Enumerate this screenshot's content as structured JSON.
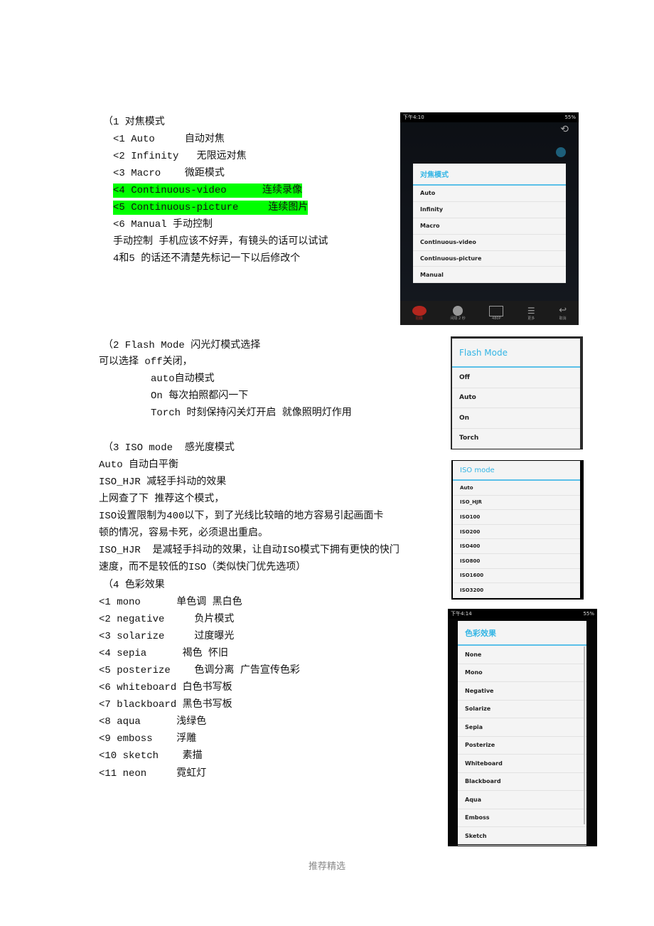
{
  "section1": {
    "lines": [
      "（1 对焦模式",
      "<1 Auto     自动对焦",
      "<2 Infinity   无限远对焦",
      "<3 Macro    微距模式",
      "<4 Continuous-video      连续录像",
      "<5 Continuous-picture     连续图片",
      "<6 Manual 手动控制",
      "手动控制 手机应该不好弄，有镜头的话可以试试",
      "4和5 的话还不清楚先标记一下以后修改个"
    ],
    "highlight_color": "#00ff00"
  },
  "section2": {
    "lines": [
      "（2 Flash Mode 闪光灯模式选择",
      "可以选择 off关闭，",
      "auto自动模式",
      "On 每次拍照都闪一下",
      "Torch 时刻保持闪关灯开启 就像照明灯作用"
    ]
  },
  "section3": {
    "lines": [
      "（3 ISO mode  感光度模式",
      "Auto 自动白平衡",
      "ISO_HJR 减轻手抖动的效果",
      "上网查了下 推荐这个模式，",
      "ISO设置限制为400以下，到了光线比较暗的地方容易引起画面卡",
      "顿的情况，容易卡死，必须退出重启。",
      "ISO_HJR  是减轻手抖动的效果，让自动ISO模式下拥有更快的快门",
      "速度，而不是较低的ISO（类似快门优先选项）"
    ]
  },
  "section4": {
    "lines": [
      "（4 色彩效果",
      "<1 mono      单色调 黑白色",
      "<2 negative     负片模式",
      "<3 solarize     过度曝光",
      "<4 sepia      褐色 怀旧",
      "<5 posterize    色调分离 广告宣传色彩",
      "<6 whiteboard 白色书写板",
      "<7 blackboard 黑色书写板",
      "<8 aqua      浅绿色",
      "<9 emboss    浮雕",
      "<10 sketch    素描",
      "<11 neon     霓虹灯"
    ]
  },
  "shot_focus": {
    "status_time": "下午4:10",
    "status_battery": "55%",
    "title": "对焦模式",
    "items": [
      "Auto",
      "Infinity",
      "Macro",
      "Continuous-video",
      "Continuous-picture",
      "Manual"
    ],
    "bottom_bar": [
      "拍摄",
      "间隔 2 秒",
      "480P",
      "更多",
      "取消"
    ]
  },
  "shot_flash": {
    "title": "Flash Mode",
    "items": [
      "Off",
      "Auto",
      "On",
      "Torch"
    ]
  },
  "shot_iso": {
    "title": "ISO mode",
    "items": [
      "Auto",
      "ISO_HJR",
      "ISO100",
      "ISO200",
      "ISO400",
      "ISO800",
      "ISO1600",
      "ISO3200"
    ]
  },
  "shot_color": {
    "status_time": "下午4:14",
    "status_battery": "55%",
    "title": "色彩效果",
    "items": [
      "None",
      "Mono",
      "Negative",
      "Solarize",
      "Sepia",
      "Posterize",
      "Whiteboard",
      "Blackboard",
      "Aqua",
      "Emboss",
      "Sketch"
    ]
  },
  "footer": "推荐精选",
  "accent_color": "#33b5e5"
}
